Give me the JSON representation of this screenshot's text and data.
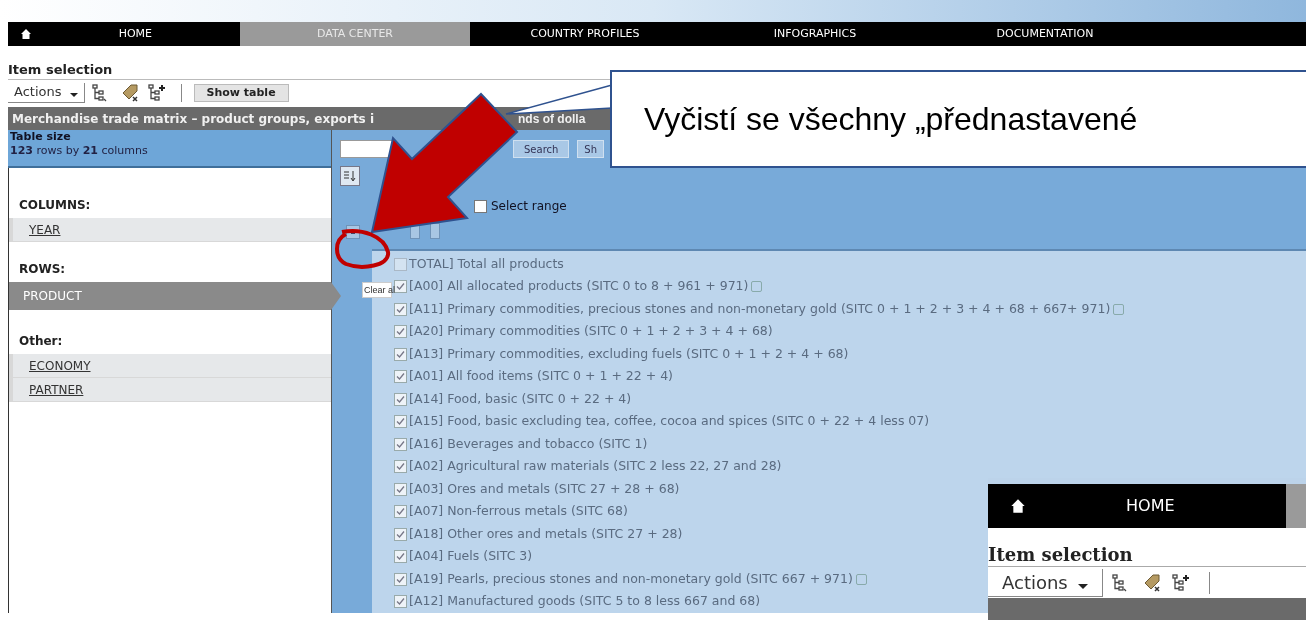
{
  "nav": {
    "tabs": [
      {
        "label": "HOME",
        "selected": false
      },
      {
        "label": "DATA CENTER",
        "selected": true
      },
      {
        "label": "COUNTRY PROFILES",
        "selected": false
      },
      {
        "label": "INFOGRAPHICS",
        "selected": false
      },
      {
        "label": "DOCUMENTATION",
        "selected": false
      }
    ]
  },
  "item_selection": {
    "title": "Item selection",
    "actions": "Actions",
    "show_table": "Show table"
  },
  "table_title": {
    "parts": [
      "Merchandise trade matrix – product groups, exports i",
      "nds of dolla"
    ]
  },
  "table_size": {
    "title": "Table size",
    "summary": "**123** rows by **21** columns"
  },
  "dimensions": {
    "columns_label": "COLUMNS:",
    "columns": [
      {
        "label": "YEAR",
        "selected": false
      }
    ],
    "rows_label": "ROWS:",
    "rows": [
      {
        "label": "PRODUCT",
        "selected": true
      }
    ],
    "other_label": "Other:",
    "other": [
      {
        "label": "ECONOMY",
        "selected": false
      },
      {
        "label": "PARTNER",
        "selected": false
      }
    ]
  },
  "search": {
    "button": "Search",
    "second_button": "Sh"
  },
  "select_range": {
    "label": "Select range",
    "checked": false
  },
  "tooltip": "Clear al",
  "products": [
    {
      "label": "TOTAL] Total all products",
      "checked": false,
      "info": false
    },
    {
      "label": "[A00] All allocated products (SITC 0 to 8 + 961 + 971)",
      "checked": true,
      "info": true
    },
    {
      "label": "[A11] Primary commodities, precious stones and non-monetary gold (SITC 0 + 1 + 2 + 3 + 4 + 68 + 667+ 971)",
      "checked": true,
      "info": true
    },
    {
      "label": "[A20] Primary commodities (SITC 0 + 1 + 2 + 3 + 4 + 68)",
      "checked": true,
      "info": false
    },
    {
      "label": "[A13] Primary commodities, excluding fuels (SITC 0 + 1 + 2 + 4 + 68)",
      "checked": true,
      "info": false
    },
    {
      "label": "[A01] All food items (SITC 0 + 1 + 22 + 4)",
      "checked": true,
      "info": false
    },
    {
      "label": "[A14] Food, basic (SITC 0 + 22 + 4)",
      "checked": true,
      "info": false
    },
    {
      "label": "[A15] Food, basic excluding tea, coffee, cocoa and spices (SITC 0 + 22 + 4 less 07)",
      "checked": true,
      "info": false
    },
    {
      "label": "[A16] Beverages and tobacco (SITC 1)",
      "checked": true,
      "info": false
    },
    {
      "label": "[A02] Agricultural raw materials (SITC 2 less 22, 27 and 28)",
      "checked": true,
      "info": false
    },
    {
      "label": "[A03] Ores and metals (SITC 27 + 28 + 68)",
      "checked": true,
      "info": false
    },
    {
      "label": "[A07] Non-ferrous metals (SITC 68)",
      "checked": true,
      "info": false
    },
    {
      "label": "[A18] Other ores and metals (SITC 27 + 28)",
      "checked": true,
      "info": false
    },
    {
      "label": "[A04] Fuels (SITC 3)",
      "checked": true,
      "info": false
    },
    {
      "label": "[A19] Pearls, precious stones and non-monetary gold (SITC 667 + 971)",
      "checked": true,
      "info": true
    },
    {
      "label": "[A12] Manufactured goods (SITC 5 to 8 less 667 and 68)",
      "checked": true,
      "info": false
    }
  ],
  "callout": {
    "text": "Vyčistí se všechny „přednastavené"
  },
  "inset": {
    "nav_label": "HOME",
    "title": "Item selection",
    "actions": "Actions"
  }
}
